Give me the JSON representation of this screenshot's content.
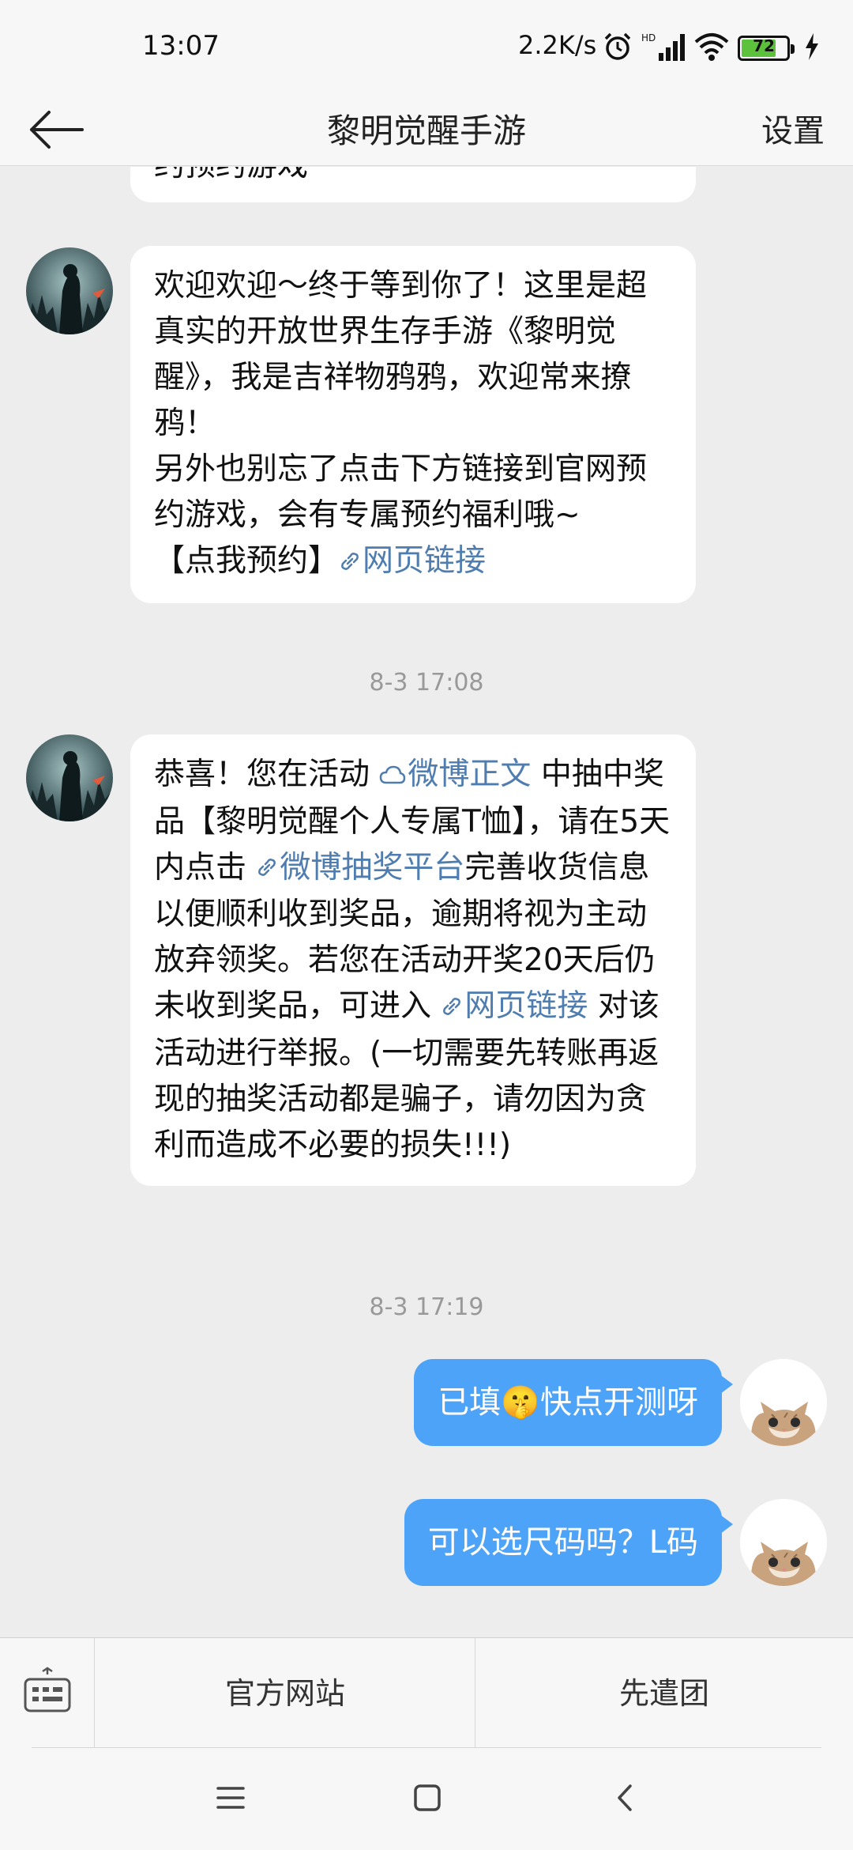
{
  "status_bar": {
    "time": "13:07",
    "net_speed": "2.2K/s",
    "battery_level": "72",
    "icons": [
      "alarm-icon",
      "hd-signal-icon",
      "wifi-icon",
      "battery-icon",
      "charging-icon"
    ]
  },
  "header": {
    "title": "黎明觉醒手游",
    "settings_label": "设置",
    "back_icon": "arrow-left-icon"
  },
  "messages": {
    "partial_top_text": "约预约游戏",
    "welcome": {
      "line1": "欢迎欢迎～终于等到你了！这里是超真实的开放世界生存手游《黎明觉醒》，我是吉祥物鸦鸦，欢迎常来撩鸦！",
      "line2": "另外也别忘了点击下方链接到官网预约游戏，会有专属预约福利哦~",
      "cta": "【点我预约】",
      "link": "网页链接"
    },
    "timestamp1": "8-3 17:08",
    "prize": {
      "t1": "恭喜！您在活动 ",
      "link_weibo": "微博正文",
      "t2": " 中抽中奖品【黎明觉醒个人专属T恤】，请在5天内点击 ",
      "link_lottery": "微博抽奖平台",
      "t3": "完善收货信息以便顺利收到奖品，逾期将视为主动放弃领奖。若您在活动开奖20天后仍未收到奖品，可进入 ",
      "link_web": "网页链接",
      "t4": " 对该活动进行举报。(一切需要先转账再返现的抽奖活动都是骗子，请勿因为贪利而造成不必要的损失!!!)"
    },
    "timestamp2": "8-3 17:19",
    "out1_a": "已填",
    "out1_emoji": "🤫",
    "out1_b": "快点开测呀",
    "out2": "可以选尺码吗？L码"
  },
  "bottom_menu": {
    "official_site": "官方网站",
    "vanguard": "先遣团"
  },
  "colors": {
    "link": "#507daf",
    "outgoing_bubble": "#4da3f7",
    "background": "#ededed",
    "battery_fill": "#5cc23c"
  }
}
